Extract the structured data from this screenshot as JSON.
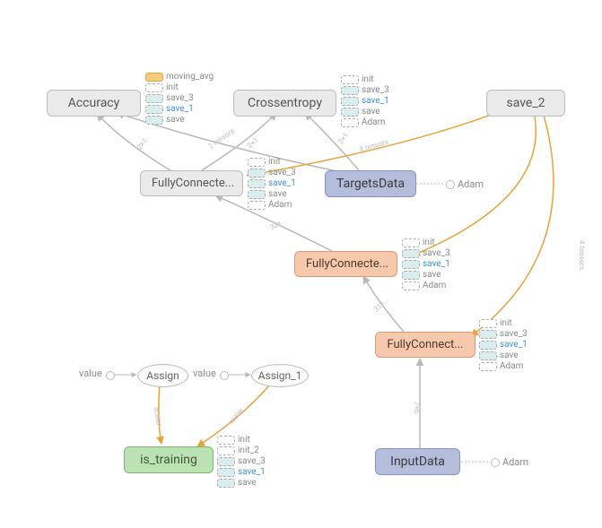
{
  "nodes": {
    "accuracy": "Accuracy",
    "crossentropy": "Crossentropy",
    "save_2": "save_2",
    "fc_top": "FullyConnecte...",
    "targets": "TargetsData",
    "fc_mid": "FullyConnecte...",
    "fc_bottom": "FullyConnect...",
    "assign": "Assign",
    "assign_1": "Assign_1",
    "is_training": "is_training",
    "input_data": "InputData"
  },
  "dots": {
    "value1": "value",
    "value2": "value",
    "adam_targets": "Adam",
    "adam_input": "Adam"
  },
  "sidelists": {
    "accuracy": [
      {
        "label": "moving_avg",
        "style": "solid-orange"
      },
      {
        "label": "init",
        "style": "hollow"
      },
      {
        "label": "save_3",
        "style": "chip"
      },
      {
        "label": "save_1",
        "style": "chip",
        "class": "save1"
      },
      {
        "label": "save",
        "style": "chip"
      }
    ],
    "crossentropy": [
      {
        "label": "init",
        "style": "hollow"
      },
      {
        "label": "save_3",
        "style": "chip"
      },
      {
        "label": "save_1",
        "style": "chip",
        "class": "save1"
      },
      {
        "label": "save",
        "style": "chip"
      },
      {
        "label": "Adam",
        "style": "hollow"
      }
    ],
    "fc_top": [
      {
        "label": "init",
        "style": "hollow"
      },
      {
        "label": "save_3",
        "style": "chip"
      },
      {
        "label": "save_1",
        "style": "chip",
        "class": "save1"
      },
      {
        "label": "save",
        "style": "chip"
      },
      {
        "label": "Adam",
        "style": "hollow"
      }
    ],
    "fc_mid": [
      {
        "label": "init",
        "style": "hollow"
      },
      {
        "label": "save_3",
        "style": "chip"
      },
      {
        "label": "save_1",
        "style": "chip",
        "class": "save1"
      },
      {
        "label": "save",
        "style": "chip"
      },
      {
        "label": "Adam",
        "style": "hollow"
      }
    ],
    "fc_bottom": [
      {
        "label": "init",
        "style": "hollow"
      },
      {
        "label": "save_3",
        "style": "chip"
      },
      {
        "label": "save_1",
        "style": "chip",
        "class": "save1"
      },
      {
        "label": "save",
        "style": "chip"
      },
      {
        "label": "Adam",
        "style": "hollow"
      }
    ],
    "is_training": [
      {
        "label": "init",
        "style": "hollow"
      },
      {
        "label": "init_2",
        "style": "hollow"
      },
      {
        "label": "save_3",
        "style": "chip"
      },
      {
        "label": "save_1",
        "style": "chip",
        "class": "save1"
      },
      {
        "label": "save",
        "style": "chip"
      }
    ]
  },
  "edge_labels": {
    "tensors_2": "2 tensors",
    "tensors_4a": "4 tensors",
    "tensors_4b": "4 tensors",
    "scalar1": "scalar",
    "scalar2": "scalar",
    "t2x1_a": "2×1",
    "t2x1_b": "2×1",
    "t2x1_c": "2×1",
    "t32_a": "32×...",
    "t32_b": "32×...",
    "t7_input": "7×6"
  }
}
